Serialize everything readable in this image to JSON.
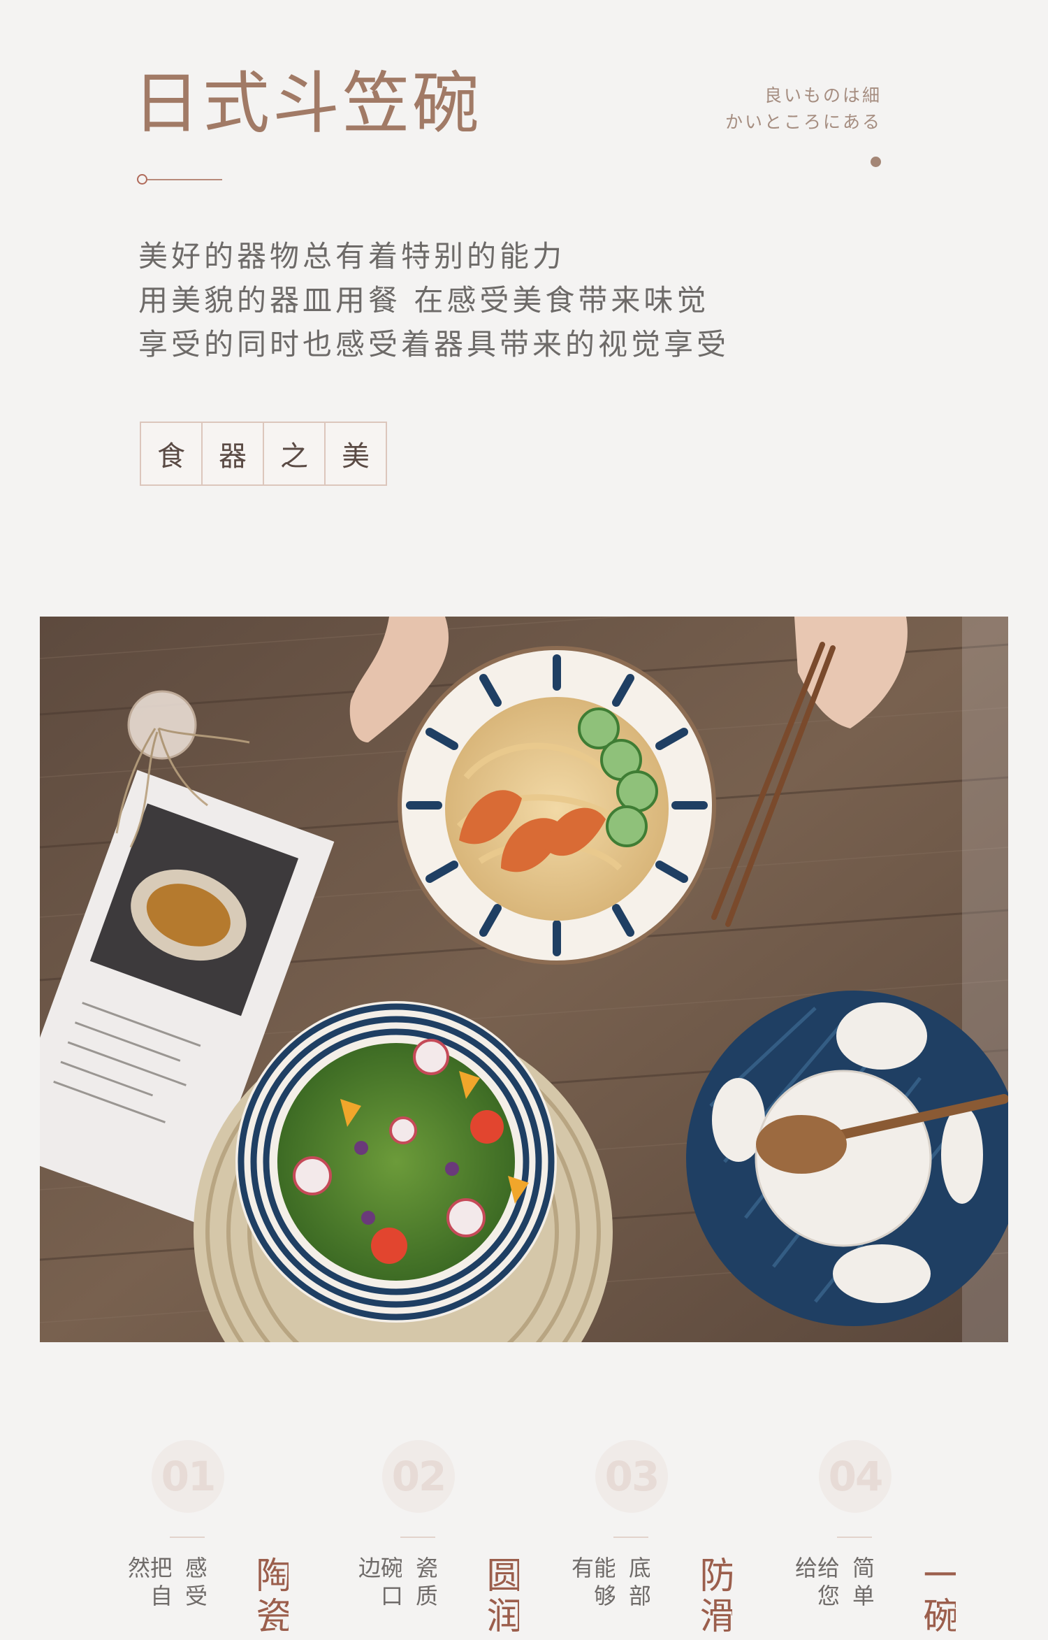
{
  "header": {
    "title": "日式斗笠碗",
    "jp_line1": "良いものは細",
    "jp_line2": "かいところにある"
  },
  "intro": {
    "lines": [
      "美好的器物总有着特别的能力",
      "用美貌的器皿用餐 在感受美食带来味觉",
      "享受的同时也感受着器具带来的视觉享受"
    ]
  },
  "tag": [
    "食",
    "器",
    "之",
    "美"
  ],
  "features": [
    {
      "num": "01",
      "title": "陶瓷",
      "col1": "感受",
      "col2": "把自然"
    },
    {
      "num": "02",
      "title": "圆润",
      "col1": "瓷质",
      "col2": "碗口边"
    },
    {
      "num": "03",
      "title": "防滑",
      "col1": "底部",
      "col2": "能够有"
    },
    {
      "num": "04",
      "title": "一碗",
      "col1": "简单",
      "col2": "给您给"
    }
  ],
  "colors": {
    "title": "#a17a66",
    "accent": "#9b5e4c",
    "background": "#f4f3f2",
    "table_wood": "#6b5446",
    "bowl_blue": "#1f3f63"
  }
}
